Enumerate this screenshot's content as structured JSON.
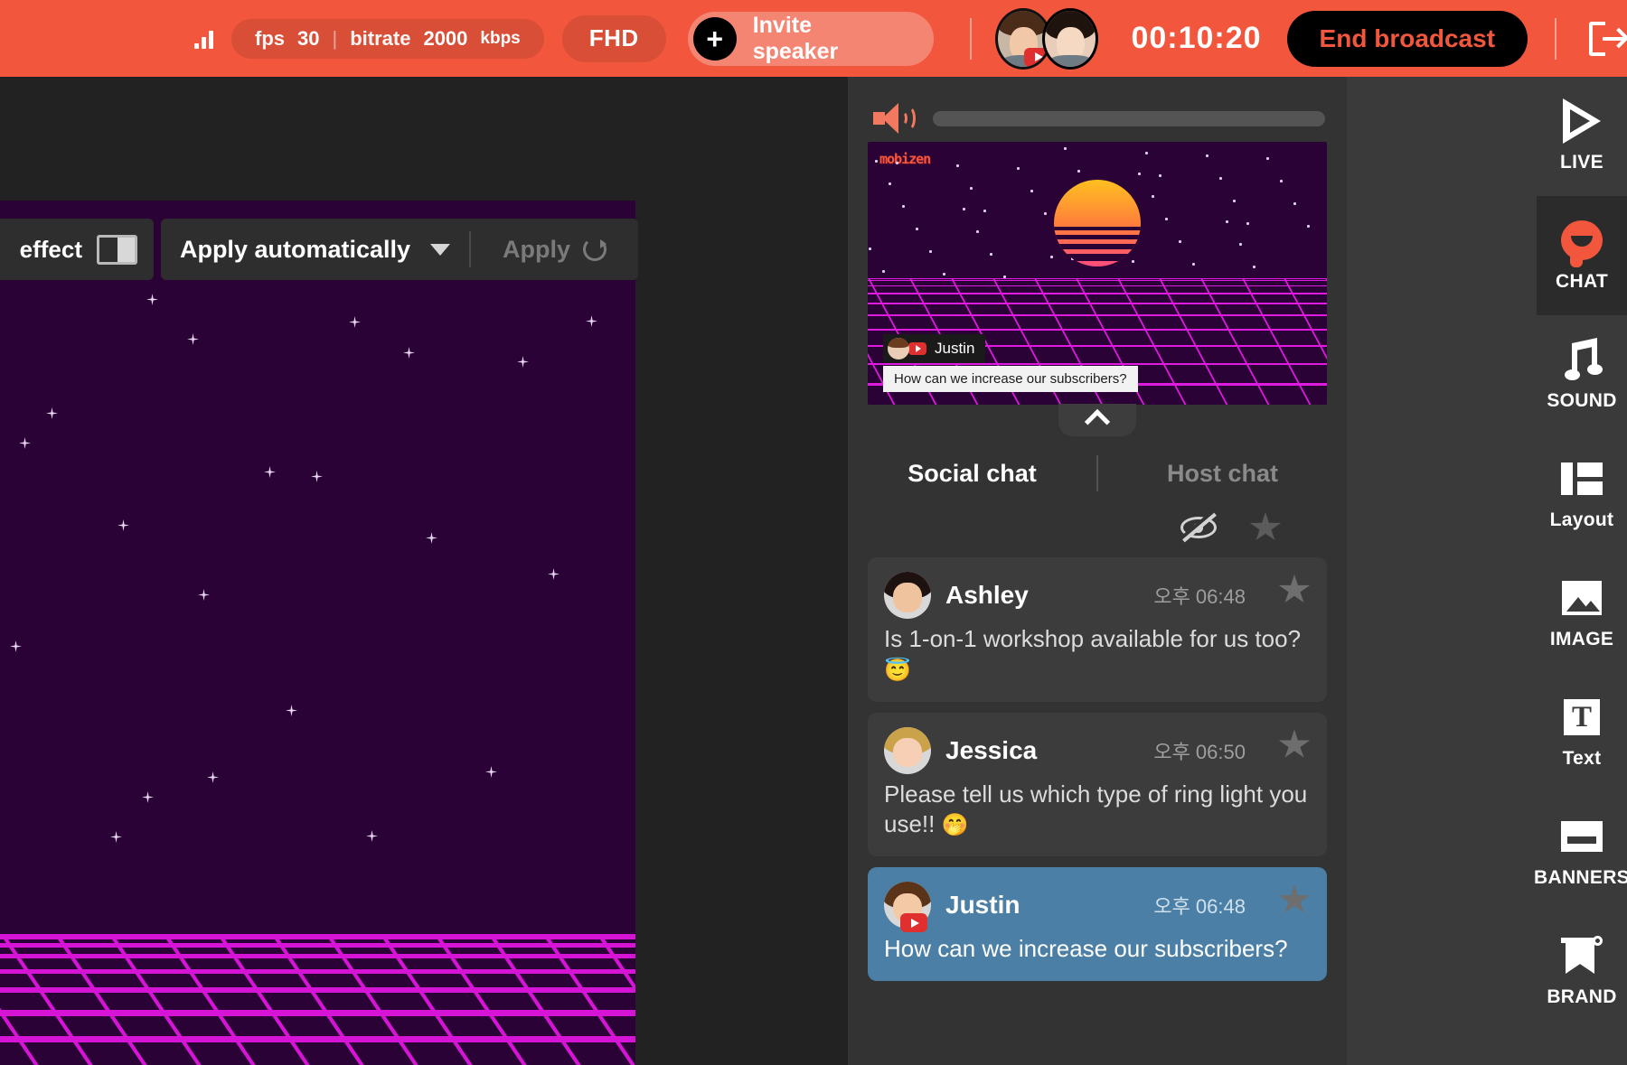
{
  "topbar": {
    "fps_label": "fps",
    "fps_value": "30",
    "separator": "|",
    "bitrate_label": "bitrate",
    "bitrate_value": "2000",
    "bitrate_unit": "kbps",
    "quality": "FHD",
    "invite_label": "Invite speaker",
    "invite_plus": "+",
    "timer": "00:10:20",
    "end_broadcast": "End broadcast"
  },
  "toolbar": {
    "effect_label": "effect",
    "apply_mode": "Apply automatically",
    "apply_button": "Apply"
  },
  "preview": {
    "watermark": "mobizen",
    "overlay_name": "Justin",
    "overlay_message": "How can we increase our subscribers?"
  },
  "chat": {
    "tab_social": "Social chat",
    "tab_host": "Host chat",
    "messages": [
      {
        "name": "Ashley",
        "time": "오후 06:48",
        "text": "Is 1-on-1 workshop available for us too? ",
        "emoji": "😇",
        "highlighted": false,
        "platform": ""
      },
      {
        "name": "Jessica",
        "time": "오후 06:50",
        "text": "Please tell us which type of ring light you use!! ",
        "emoji": "🤭",
        "highlighted": false,
        "platform": ""
      },
      {
        "name": "Justin",
        "time": "오후 06:48",
        "text": "How can we increase our subscribers?",
        "emoji": "",
        "highlighted": true,
        "platform": "youtube"
      }
    ]
  },
  "sidebar": {
    "items": [
      {
        "label": "LIVE",
        "icon": "play-icon",
        "active": false
      },
      {
        "label": "CHAT",
        "icon": "chat-bubble-icon",
        "active": true
      },
      {
        "label": "SOUND",
        "icon": "music-note-icon",
        "active": false
      },
      {
        "label": "Layout",
        "icon": "layout-icon",
        "active": false
      },
      {
        "label": "IMAGE",
        "icon": "image-icon",
        "active": false
      },
      {
        "label": "Text",
        "icon": "text-icon",
        "active": false
      },
      {
        "label": "BANNERS",
        "icon": "banner-icon",
        "active": false
      },
      {
        "label": "BRAND",
        "icon": "brand-flag-icon",
        "active": false
      }
    ]
  },
  "colors": {
    "brand": "#f2573d",
    "canvas_bg": "#2b0235",
    "grid": "#d614d6",
    "highlight": "#4b7fa5"
  }
}
